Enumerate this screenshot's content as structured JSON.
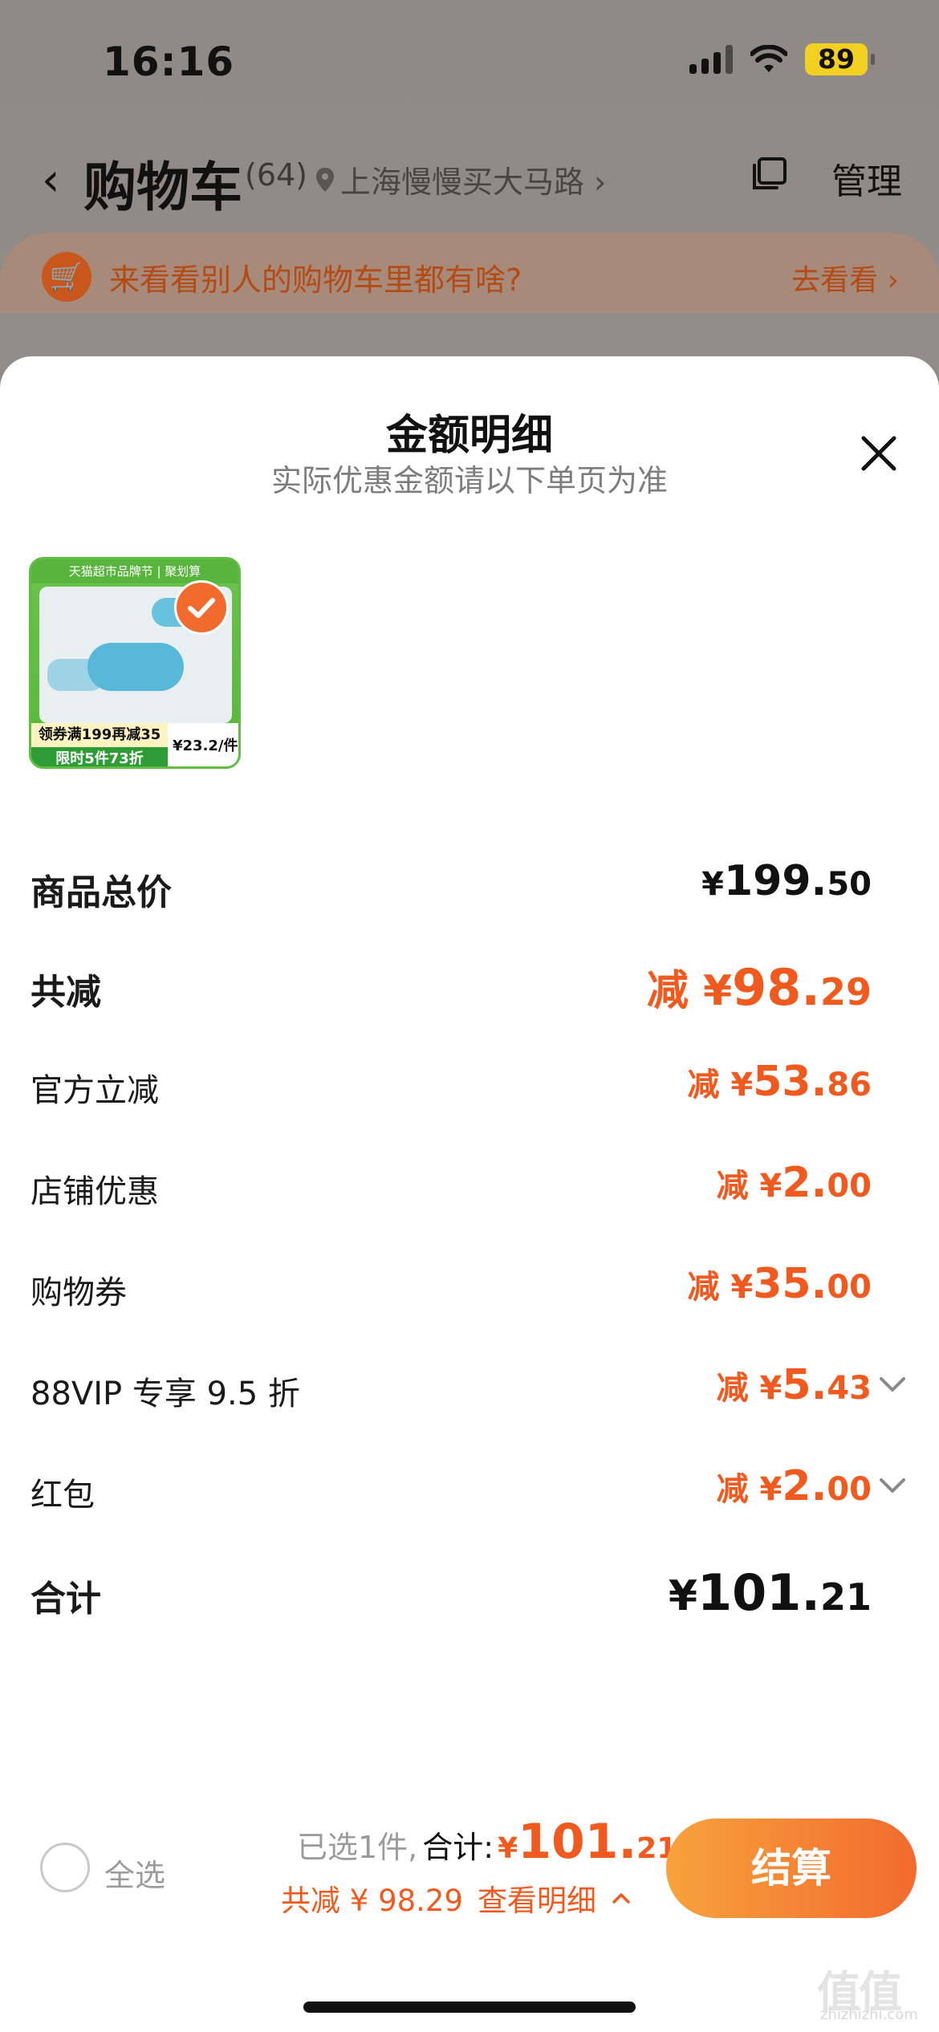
{
  "status_bar": {
    "time": "16:16",
    "battery": "89"
  },
  "nav": {
    "back": "‹",
    "title": "购物车",
    "count": "(64)",
    "location": "上海慢慢买大马路 ›",
    "manage": "管理"
  },
  "banner": {
    "text": "来看看别人的购物车里都有啥?",
    "link": "去看看 ›"
  },
  "sheet": {
    "title": "金额明细",
    "subtitle": "实际优惠金额请以下单页为准"
  },
  "product": {
    "top_text": "天猫超市品牌节 | 聚划算",
    "promo": "领券满199再减35",
    "limit": "限时5件73折",
    "price": "¥23.2/件"
  },
  "breakdown": {
    "total_price": {
      "label": "商品总价",
      "prefix": "¥",
      "int": "199.",
      "dec": "50"
    },
    "total_discount": {
      "label": "共减",
      "prefix": "减 ¥",
      "int": "98.",
      "dec": "29"
    },
    "official": {
      "label": "官方立减",
      "prefix": "减 ¥",
      "int": "53.",
      "dec": "86"
    },
    "store": {
      "label": "店铺优惠",
      "prefix": "减 ¥",
      "int": "2.",
      "dec": "00"
    },
    "coupon": {
      "label": "购物券",
      "prefix": "减 ¥",
      "int": "35.",
      "dec": "00"
    },
    "vip": {
      "label": "88VIP 专享 9.5 折",
      "prefix": "减 ¥",
      "int": "5.",
      "dec": "43"
    },
    "redpacket": {
      "label": "红包",
      "prefix": "减 ¥",
      "int": "2.",
      "dec": "00"
    },
    "subtotal": {
      "label": "合计",
      "prefix": "¥",
      "int": "101.",
      "dec": "21"
    }
  },
  "bottom_bar": {
    "select_all": "全选",
    "selected": "已选1件,",
    "sum_label": "合计:",
    "sum_prefix": "¥",
    "sum_int": "101.",
    "sum_dec": "21",
    "discount_text": "共减 ¥ 98.29",
    "detail_link": "查看明细",
    "checkout": "结算"
  },
  "watermark": {
    "main": "值值值",
    "sub": "zhizhizhi.com"
  },
  "colors": {
    "accent": "#f05a1e",
    "checkout_gradient_start": "#f7a23c",
    "checkout_gradient_end": "#f26b2e"
  }
}
